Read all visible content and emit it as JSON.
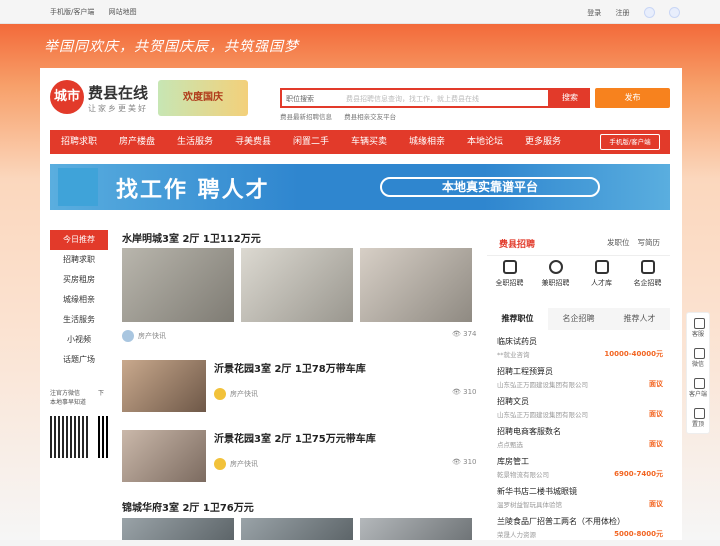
{
  "topbar": {
    "mobile": "手机版/客户端",
    "sitemap": "网站地图",
    "login": "登录",
    "register": "注册"
  },
  "banner": {
    "slogan": "举国同欢庆，共贺国庆辰，共筑强国梦"
  },
  "logo": {
    "mark": "城市",
    "title": "费县在线",
    "subtitle": "让家乡更美好",
    "badge": "欢度国庆"
  },
  "search": {
    "category": "职位搜索",
    "placeholder": "费县招聘信息查询，找工作，就上费县在线",
    "button": "搜索",
    "publish": "发布",
    "hot": [
      "费县最新招聘信息",
      "费县相亲交友平台"
    ]
  },
  "nav": {
    "items": [
      "招聘求职",
      "房产楼盘",
      "生活服务",
      "寻美费县",
      "闲置二手",
      "车辆买卖",
      "城缘相亲",
      "本地论坛",
      "更多服务"
    ],
    "mobile": "手机版/客户端"
  },
  "ad": {
    "headline": "找工作 聘人才",
    "pill": "本地真实靠谱平台",
    "tag": "广告"
  },
  "leftnav": {
    "items": [
      "今日推荐",
      "招聘求职",
      "买房租房",
      "城缘相亲",
      "生活服务",
      "小视频",
      "话题广场"
    ],
    "wx": "注官方微信",
    "wx_sub": "本地事早知道",
    "wx2": "下"
  },
  "feed": [
    {
      "title": "水岸明城3室 2厅 1卫112万元",
      "source": "房产快讯",
      "views": "374"
    },
    {
      "title": "沂景花园3室 2厅 1卫78万带车库",
      "source": "房产快讯",
      "views": "310"
    },
    {
      "title": "沂景花园3室 2厅 1卫75万元带车库",
      "source": "房产快讯",
      "views": "310"
    },
    {
      "title": "锦城华府3室 2厅 1卫76万元"
    }
  ],
  "right": {
    "title": "费县招聘",
    "link1": "发职位",
    "link2": "写简历",
    "icons": [
      "全职招聘",
      "兼职招聘",
      "人才库",
      "名企招聘"
    ],
    "tabs": [
      "推荐职位",
      "名企招聘",
      "推荐人才"
    ],
    "jobs": [
      {
        "name": "临床试药员",
        "company": "**就业咨询",
        "salary": "10000-40000元"
      },
      {
        "name": "招聘工程预算员",
        "company": "山东弘正万圆建设集团有限公司",
        "salary": "面议"
      },
      {
        "name": "招聘文员",
        "company": "山东弘正万圆建设集团有限公司",
        "salary": "面议"
      },
      {
        "name": "招聘电商客服数名",
        "company": "点点甄选",
        "salary": "面议"
      },
      {
        "name": "库房管工",
        "company": "乾景物流有限公司",
        "salary": "6900-7400元"
      },
      {
        "name": "新华书店二楼书城眼镜",
        "company": "温罗树益智玩具体验馆",
        "salary": "面议"
      },
      {
        "name": "兰陵食品厂招普工两名（不用体检）",
        "company": "荣晟人力资源",
        "salary": "5000-8000元"
      }
    ]
  },
  "side": [
    "客服",
    "微信",
    "客户端",
    "置顶"
  ]
}
